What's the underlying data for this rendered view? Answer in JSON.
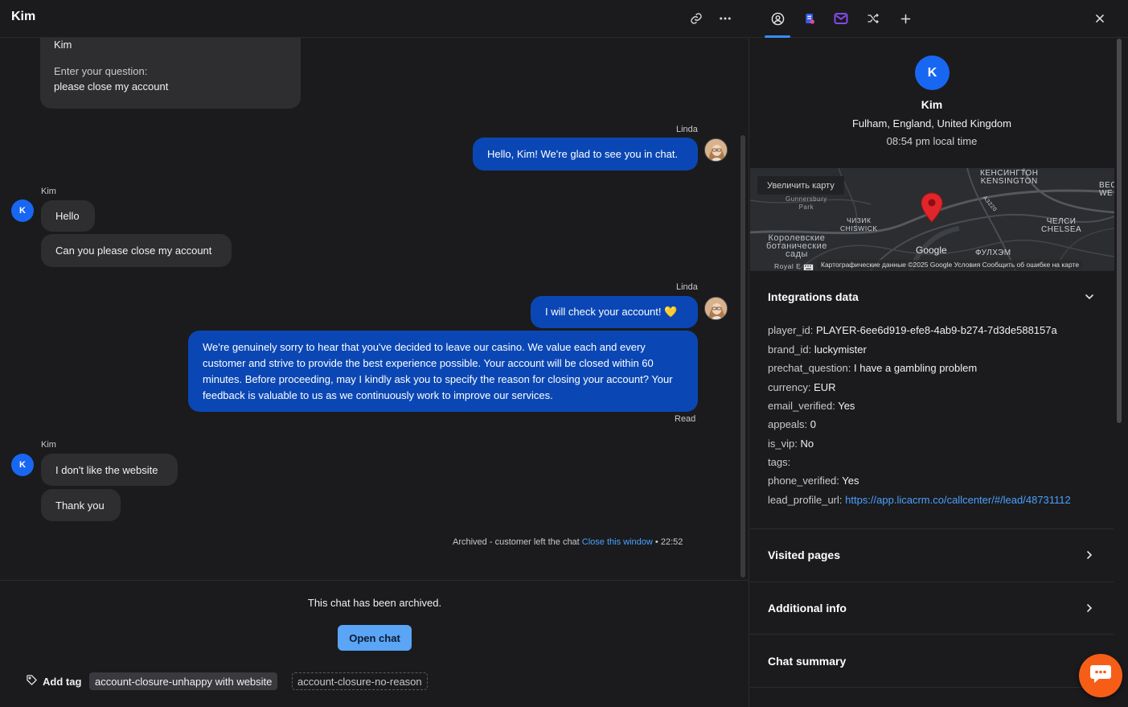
{
  "header": {
    "title": "Kim"
  },
  "messages": {
    "top_card": {
      "name": "Kim",
      "prompt": "Enter your question:",
      "question": "please close my account"
    },
    "agent_name": "Linda",
    "customer_name": "Kim",
    "customer_initial": "K",
    "m1": "Hello, Kim! We're glad to see you in chat.",
    "m2": "Hello",
    "m3": "Can you please close my account",
    "m4": "I will check your account! 💛",
    "m5": "We're genuinely sorry to hear that you've decided to leave our casino. We value each and every customer and strive to provide the best experience possible. Your account will be closed within 60 minutes. Before proceeding, may I kindly ask you to specify the reason for closing your account? Your feedback is valuable to us as we continuously work to improve our services.",
    "read": "Read",
    "m6": "I don't like the website",
    "m7": "Thank you",
    "archived_note": "Archived - customer left the chat",
    "close_window": "Close this window",
    "bullet": "•",
    "archived_time": "22:52"
  },
  "footer": {
    "archived_text": "This chat has been archived.",
    "open_chat": "Open chat",
    "add_tag": "Add tag",
    "tags": [
      "account-closure-unhappy with website",
      "account-closure-no-reason"
    ]
  },
  "profile": {
    "initial": "K",
    "name": "Kim",
    "location": "Fulham, England, United Kingdom",
    "local_time": "08:54 pm local time"
  },
  "map": {
    "enlarge": "Увеличить карту",
    "labels": {
      "kensington": "КЕНСИНГТОН\nKENSINGTON",
      "gunnersbury": "Gunnersbury\nPark",
      "chiswick": "ЧИЗИК\nCHISWICK",
      "chelsea": "ЧЕЛСИ\nCHELSEA",
      "kew": "Королевские\nботанические\nсады",
      "fulham": "ФУЛХЭМ",
      "bec": "BEC\nWE",
      "road": "A3220",
      "google": "Google",
      "royal": "Royal E"
    },
    "attribution": "Картографические данные ©2025 Google    Условия    Сообщить об ошибке на карте"
  },
  "integrations": {
    "title": "Integrations data",
    "fields": [
      {
        "k": "player_id:",
        "v": "PLAYER-6ee6d919-efe8-4ab9-b274-7d3de588157a"
      },
      {
        "k": "brand_id:",
        "v": "luckymister"
      },
      {
        "k": "prechat_question:",
        "v": "I have a gambling problem"
      },
      {
        "k": "currency:",
        "v": "EUR"
      },
      {
        "k": "email_verified:",
        "v": "Yes"
      },
      {
        "k": "appeals:",
        "v": "0"
      },
      {
        "k": "is_vip:",
        "v": "No"
      },
      {
        "k": "tags:",
        "v": ""
      },
      {
        "k": "phone_verified:",
        "v": "Yes"
      },
      {
        "k": "lead_profile_url:",
        "v": "https://app.licacrm.co/callcenter/#/lead/48731112"
      }
    ]
  },
  "sections": {
    "visited": "Visited pages",
    "additional": "Additional info",
    "summary": "Chat summary"
  },
  "colors": {
    "accent": "#1867f2",
    "agent_bubble": "#0b47b4",
    "link": "#4aa0ff",
    "fab": "#f65e18"
  }
}
